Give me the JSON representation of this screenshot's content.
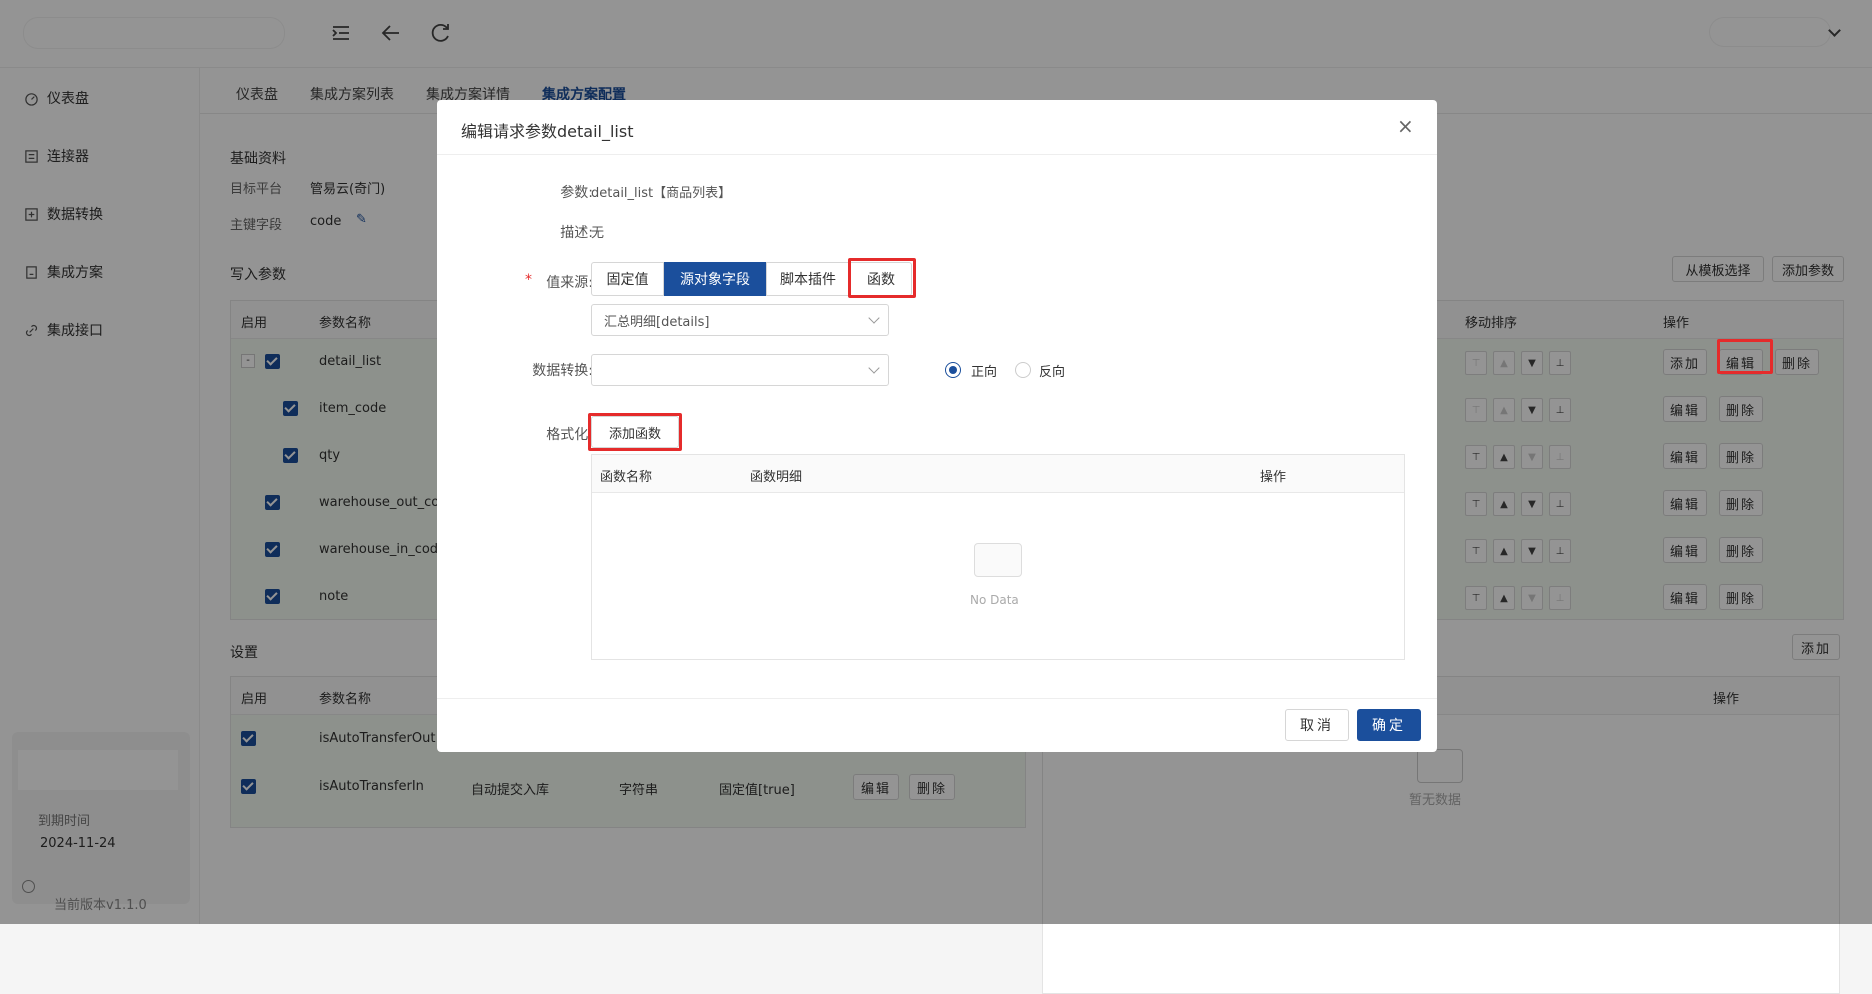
{
  "topbar": {
    "brand": "",
    "user": ""
  },
  "sidebar": {
    "items": [
      {
        "label": "仪表盘",
        "icon": "dashboard-icon"
      },
      {
        "label": "连接器",
        "icon": "connector-icon"
      },
      {
        "label": "数据转换",
        "icon": "transform-icon"
      },
      {
        "label": "集成方案",
        "icon": "solution-icon"
      },
      {
        "label": "集成接口",
        "icon": "link-icon"
      }
    ],
    "expire_label": "到期时间",
    "expire_date": "2024-11-24",
    "version": "当前版本v1.1.0"
  },
  "tabs": [
    "仪表盘",
    "集成方案列表",
    "集成方案详情",
    "集成方案配置"
  ],
  "active_tab": "集成方案配置",
  "page": {
    "section_basic": "基础资料",
    "target_platform_label": "目标平台",
    "target_platform_value": "管易云(奇门)",
    "pk_label": "主键字段",
    "pk_value": "code",
    "write_params_title": "写入参数",
    "from_template_btn": "从模板选择",
    "add_param_btn": "添加参数",
    "write_table": {
      "headers": {
        "enable": "启用",
        "name": "参数名称",
        "move": "移动排序",
        "ops": "操作"
      },
      "rows": [
        {
          "name": "detail_list",
          "ops": [
            "添加",
            "编辑",
            "删除"
          ]
        },
        {
          "name": "item_code",
          "ops": [
            "编辑",
            "删除"
          ]
        },
        {
          "name": "qty",
          "ops": [
            "编辑",
            "删除"
          ]
        },
        {
          "name": "warehouse_out_code",
          "ops": [
            "编辑",
            "删除"
          ]
        },
        {
          "name": "warehouse_in_code",
          "ops": [
            "编辑",
            "删除"
          ]
        },
        {
          "name": "note",
          "ops": [
            "编辑",
            "删除"
          ]
        }
      ]
    },
    "settings_title": "设置",
    "settings_add_btn": "添加",
    "settings_table": {
      "headers": {
        "enable": "启用",
        "name": "参数名称"
      },
      "rows": [
        {
          "name": "isAutoTransferOut"
        },
        {
          "name": "isAutoTransferIn",
          "desc": "自动提交入库",
          "type": "字符串",
          "value": "固定值[true]",
          "ops": [
            "编辑",
            "删除"
          ]
        }
      ]
    },
    "right_table_ops_header": "操作",
    "right_empty": "暂无数据"
  },
  "modal": {
    "title": "编辑请求参数detail_list",
    "param_label": "参数:",
    "param_value": "detail_list【商品列表】",
    "desc_label": "描述:",
    "desc_value": "无",
    "source_label": "值来源:",
    "source_required": "*",
    "source_options": [
      "固定值",
      "源对象字段",
      "脚本插件",
      "函数"
    ],
    "source_selected": "源对象字段",
    "source_field_value": "汇总明细[details]",
    "transform_label": "数据转换:",
    "transform_value": "",
    "direction_options": [
      "正向",
      "反向"
    ],
    "direction_selected": "正向",
    "format_label": "格式化:",
    "add_func_btn": "添加函数",
    "func_table_headers": [
      "函数名称",
      "函数明细",
      "操作"
    ],
    "func_table_empty": "No Data",
    "cancel_btn": "取消",
    "ok_btn": "确定"
  },
  "colors": {
    "primary": "#1b4f9c",
    "highlight": "#e52b2b",
    "row_bg": "#f3faf1"
  }
}
